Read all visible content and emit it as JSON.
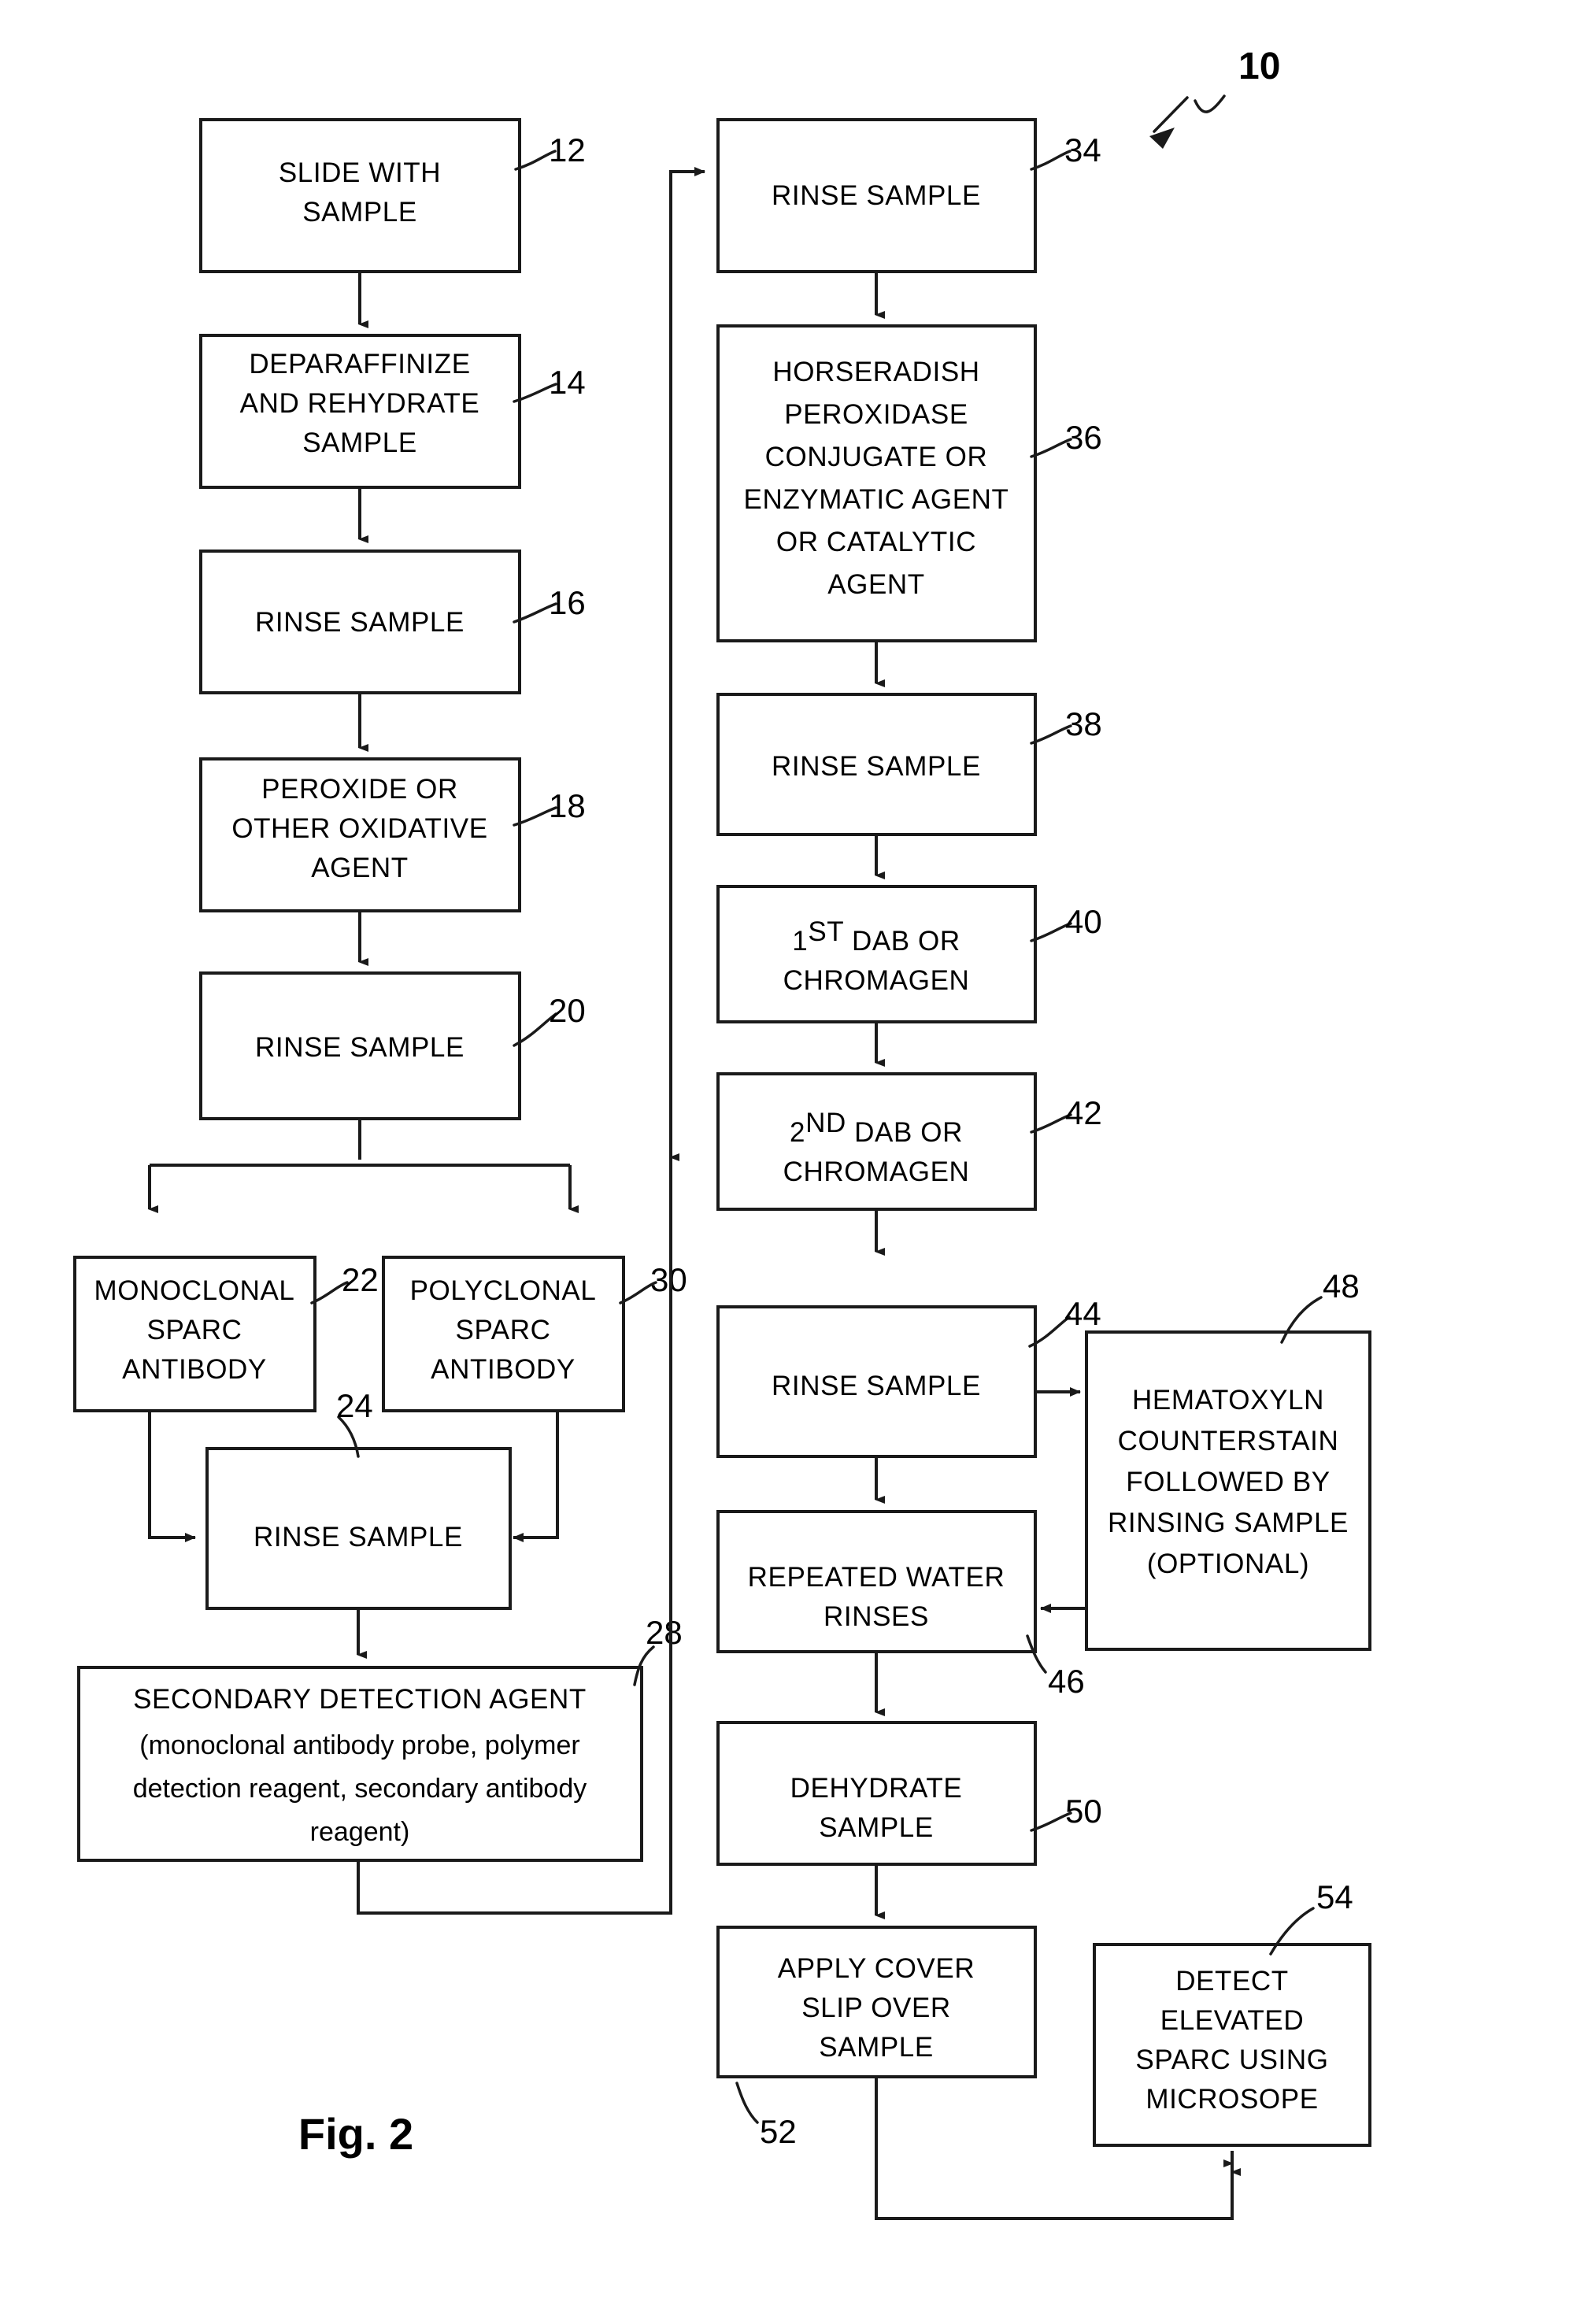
{
  "figure": {
    "label": "Fig. 2",
    "main_reference": "10"
  },
  "nodes": [
    {
      "id": "n12",
      "ref": "12",
      "lines": [
        "SLIDE WITH",
        "SAMPLE"
      ]
    },
    {
      "id": "n14",
      "ref": "14",
      "lines": [
        "DEPARAFFINIZE",
        "AND REHYDRATE",
        "SAMPLE"
      ]
    },
    {
      "id": "n16",
      "ref": "16",
      "lines": [
        "RINSE SAMPLE"
      ]
    },
    {
      "id": "n18",
      "ref": "18",
      "lines": [
        "PEROXIDE OR",
        "OTHER OXIDATIVE",
        "AGENT"
      ]
    },
    {
      "id": "n20",
      "ref": "20",
      "lines": [
        "RINSE SAMPLE"
      ]
    },
    {
      "id": "n22",
      "ref": "22",
      "lines": [
        "MONOCLONAL",
        "SPARC",
        "ANTIBODY"
      ]
    },
    {
      "id": "n30",
      "ref": "30",
      "lines": [
        "POLYCLONAL",
        "SPARC",
        "ANTIBODY"
      ]
    },
    {
      "id": "n24",
      "ref": "24",
      "lines": [
        "RINSE SAMPLE"
      ]
    },
    {
      "id": "n28",
      "ref": "28",
      "lines": [
        "SECONDARY DETECTION AGENT",
        "(monoclonal antibody probe, polymer",
        "detection reagent, secondary antibody",
        "reagent)"
      ]
    },
    {
      "id": "n34",
      "ref": "34",
      "lines": [
        "RINSE SAMPLE"
      ]
    },
    {
      "id": "n36",
      "ref": "36",
      "lines": [
        "HORSERADISH",
        "PEROXIDASE",
        "CONJUGATE OR",
        "ENZYMATIC AGENT",
        "OR CATALYTIC",
        "AGENT"
      ]
    },
    {
      "id": "n38",
      "ref": "38",
      "lines": [
        "RINSE SAMPLE"
      ]
    },
    {
      "id": "n40",
      "ref": "40",
      "lines": [
        "1ST DAB OR",
        "CHROMAGEN"
      ],
      "superscript": "ST"
    },
    {
      "id": "n42",
      "ref": "42",
      "lines": [
        "2ND DAB OR",
        "CHROMAGEN"
      ],
      "superscript": "ND"
    },
    {
      "id": "n44",
      "ref": "44",
      "lines": [
        "RINSE SAMPLE"
      ]
    },
    {
      "id": "n46",
      "ref": "46",
      "lines": [
        "REPEATED WATER",
        "RINSES"
      ]
    },
    {
      "id": "n48",
      "ref": "48",
      "lines": [
        "HEMATOXYLN",
        "COUNTERSTAIN",
        "FOLLOWED BY",
        "RINSING SAMPLE",
        "(OPTIONAL)"
      ]
    },
    {
      "id": "n50",
      "ref": "50",
      "lines": [
        "DEHYDRATE",
        "SAMPLE"
      ]
    },
    {
      "id": "n52",
      "ref": "52",
      "lines": [
        "APPLY COVER",
        "SLIP OVER",
        "SAMPLE"
      ]
    },
    {
      "id": "n54",
      "ref": "54",
      "lines": [
        "DETECT",
        "ELEVATED",
        "SPARC USING",
        "MICROSOPE"
      ]
    }
  ],
  "text": {
    "n12_l0": "SLIDE WITH",
    "n12_l1": "SAMPLE",
    "n12_ref": "12",
    "n14_l0": "DEPARAFFINIZE",
    "n14_l1": "AND REHYDRATE",
    "n14_l2": "SAMPLE",
    "n14_ref": "14",
    "n16_l0": "RINSE SAMPLE",
    "n16_ref": "16",
    "n18_l0": "PEROXIDE OR",
    "n18_l1": "OTHER OXIDATIVE",
    "n18_l2": "AGENT",
    "n18_ref": "18",
    "n20_l0": "RINSE SAMPLE",
    "n20_ref": "20",
    "n22_l0": "MONOCLONAL",
    "n22_l1": "SPARC",
    "n22_l2": "ANTIBODY",
    "n22_ref": "22",
    "n30_l0": "POLYCLONAL",
    "n30_l1": "SPARC",
    "n30_l2": "ANTIBODY",
    "n30_ref": "30",
    "n24_l0": "RINSE SAMPLE",
    "n24_ref": "24",
    "n28_l0": "SECONDARY DETECTION AGENT",
    "n28_l1": "(monoclonal antibody probe, polymer",
    "n28_l2": "detection reagent, secondary antibody",
    "n28_l3": "reagent)",
    "n28_ref": "28",
    "n34_l0": "RINSE SAMPLE",
    "n34_ref": "34",
    "n36_l0": "HORSERADISH",
    "n36_l1": "PEROXIDASE",
    "n36_l2": "CONJUGATE OR",
    "n36_l3": "ENZYMATIC AGENT",
    "n36_l4": "OR CATALYTIC",
    "n36_l5": "AGENT",
    "n36_ref": "36",
    "n38_l0": "RINSE SAMPLE",
    "n38_ref": "38",
    "n40_num": "1",
    "n40_sup": "ST",
    "n40_rest": " DAB OR",
    "n40_l1": "CHROMAGEN",
    "n40_ref": "40",
    "n42_num": "2",
    "n42_sup": "ND",
    "n42_rest": " DAB OR",
    "n42_l1": "CHROMAGEN",
    "n42_ref": "42",
    "n44_l0": "RINSE SAMPLE",
    "n44_ref": "44",
    "n46_l0": "REPEATED WATER",
    "n46_l1": "RINSES",
    "n46_ref": "46",
    "n48_l0": "HEMATOXYLN",
    "n48_l1": "COUNTERSTAIN",
    "n48_l2": "FOLLOWED BY",
    "n48_l3": "RINSING SAMPLE",
    "n48_l4": "(OPTIONAL)",
    "n48_ref": "48",
    "n50_l0": "DEHYDRATE",
    "n50_l1": "SAMPLE",
    "n50_ref": "50",
    "n52_l0": "APPLY COVER",
    "n52_l1": "SLIP OVER",
    "n52_l2": "SAMPLE",
    "n52_ref": "52",
    "n54_l0": "DETECT",
    "n54_l1": "ELEVATED",
    "n54_l2": "SPARC USING",
    "n54_l3": "MICROSOPE",
    "n54_ref": "54",
    "fig_label": "Fig. 2",
    "main_ref": "10"
  },
  "colors": {
    "ink": "#1a1a1a",
    "paper": "#ffffff"
  }
}
